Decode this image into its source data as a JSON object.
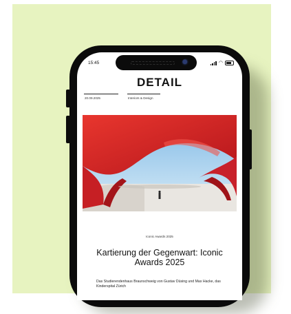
{
  "status_bar": {
    "time": "15:45"
  },
  "site": {
    "logo": "DETAIL"
  },
  "article": {
    "date": "20.09.2025",
    "category": "Interiors & Design",
    "kicker": "Iconic Awards 2025",
    "headline": "Kartierung der Gegenwart: Iconic Awards 2025",
    "teaser": "Das Studierendenhaus Braunschweig von Gustav Düsing und Max Hacke, das Kinderspital Zürich"
  },
  "colors": {
    "background": "#e7f3c0",
    "phone_frame": "#0b0b0b",
    "sculpture_red": "#d8252a",
    "sky": "#a9d3ef"
  },
  "icons": [
    "signal-icon",
    "wifi-icon",
    "battery-icon"
  ]
}
